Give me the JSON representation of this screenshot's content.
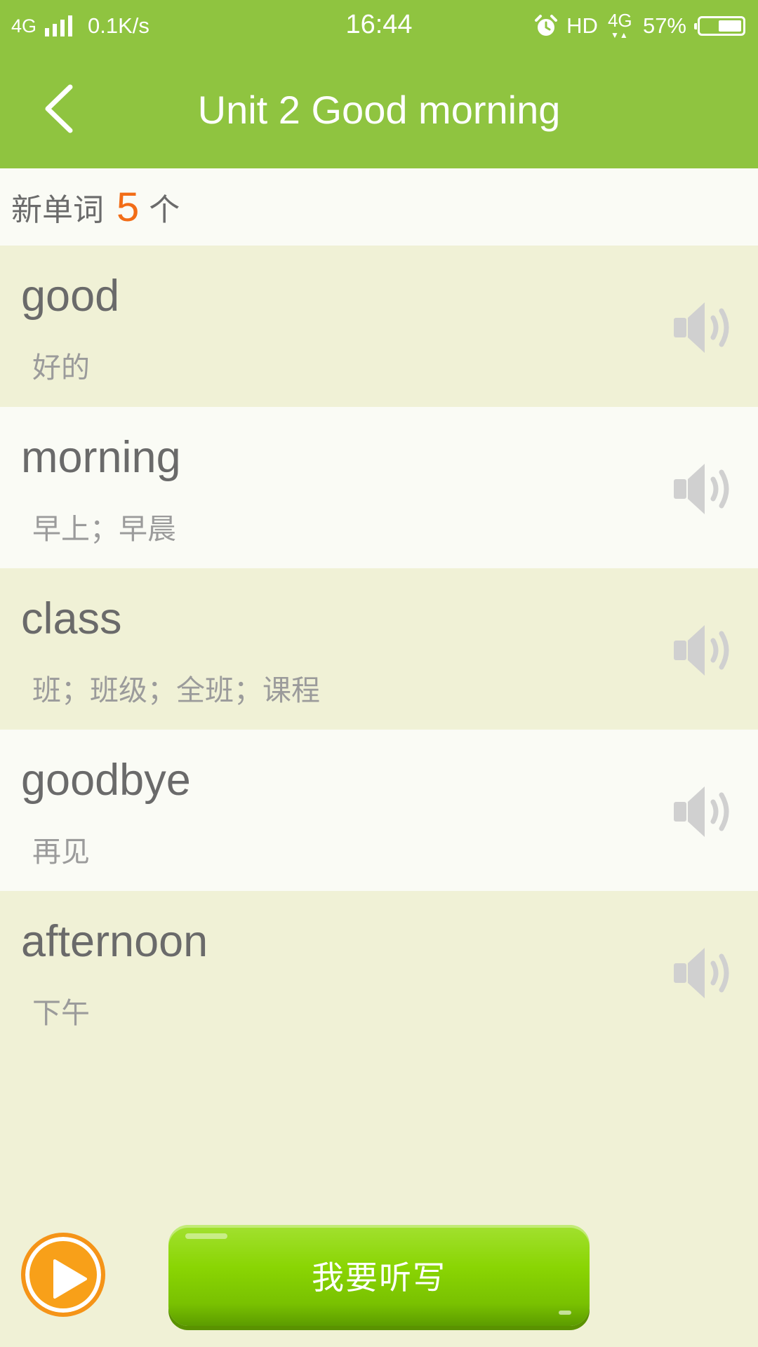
{
  "status_bar": {
    "network": "4G",
    "speed": "0.1K/s",
    "time": "16:44",
    "hd": "HD",
    "network2": "4G",
    "battery_percent": "57%",
    "battery_level": 0.57,
    "signal_icon": "signal-bars-icon",
    "alarm_icon": "alarm-clock-icon",
    "battery_icon": "battery-icon"
  },
  "header": {
    "title": "Unit 2 Good morning",
    "back_icon": "chevron-left-icon",
    "background_color": "#8fc440"
  },
  "summary": {
    "label": "新单词",
    "count": "5",
    "unit": "个",
    "count_color": "#f26d17"
  },
  "words": [
    {
      "word": "good",
      "meaning": "好的"
    },
    {
      "word": "morning",
      "meaning": "早上；早晨"
    },
    {
      "word": "class",
      "meaning": "班；班级；全班；课程"
    },
    {
      "word": "goodbye",
      "meaning": "再见"
    },
    {
      "word": "afternoon",
      "meaning": "下午"
    }
  ],
  "footer": {
    "play_icon": "play-icon",
    "dictation_label": "我要听写",
    "accent_color": "#8ad503"
  }
}
